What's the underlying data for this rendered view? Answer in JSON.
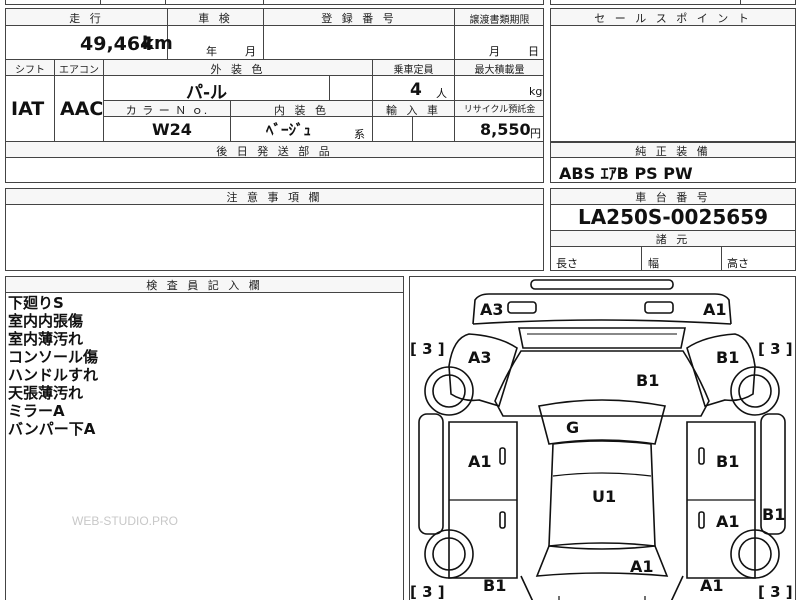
{
  "top": {
    "mileage_label": "走 行",
    "mileage_value": "49,464",
    "mileage_unit": "km",
    "inspection_label": "車 検",
    "inspection_year_unit": "年",
    "inspection_month_unit": "月",
    "reg_label": "登 録 番 号",
    "transfer_label": "譲渡書類期限",
    "transfer_month_unit": "月",
    "transfer_day_unit": "日",
    "shift_label": "シフト",
    "shift_value": "IAT",
    "ac_label": "エアコン",
    "ac_value": "AAC",
    "exterior_label": "外 装 色",
    "exterior_value": "パ-ル",
    "capacity_label": "乗車定員",
    "capacity_value": "4",
    "capacity_unit": "人",
    "load_label": "最大積載量",
    "load_unit": "kg",
    "color_no_label": "カ ラ ー Ｎ ｏ.",
    "color_no_value": "W24",
    "interior_label": "内 装 色",
    "interior_value": "ﾍﾞｰｼﾞｭ",
    "interior_unit": "系",
    "import_label": "輸 入 車",
    "recycle_label": "リサイクル預託金",
    "recycle_value": "8,550",
    "recycle_unit": "円",
    "parts_label": "後 日 発 送 部 品"
  },
  "sales": {
    "label": "セ ー ル ス ポ イ ン ト"
  },
  "equipment": {
    "label": "純 正 装 備",
    "value": "ABS ｴｱB PS PW"
  },
  "caution": {
    "label": "注 意 事 項 欄"
  },
  "chassis": {
    "label": "車 台 番 号",
    "value": "LA250S-0025659",
    "dims_label": "諸 元",
    "length_label": "長さ",
    "width_label": "幅",
    "height_label": "高さ"
  },
  "inspector": {
    "label": "検 査 員 記 入 欄",
    "notes": [
      "下廻りS",
      "室内内張傷",
      "室内薄汚れ",
      "コンソール傷",
      "ハンドルすれ",
      "天張薄汚れ",
      "ミラーA",
      "バンパー下A"
    ]
  },
  "diagram": {
    "marks": {
      "front_left": "A3",
      "front_right": "A1",
      "fender_left": "A3",
      "fender_right": "B1",
      "hood": "B1",
      "roof_front": "G",
      "roof": "U1",
      "door_fl": "A1",
      "door_fr": "B1",
      "door_rr": "A1",
      "side_rr": "B1",
      "trunk": "A1",
      "rear_left": "B1",
      "rear_right": "A1"
    },
    "tires": {
      "fl": "[ 3 ]",
      "fr": "[ 3 ]",
      "rl": "[ 3 ]",
      "rr": "[ 3 ]"
    }
  },
  "watermark": "WEB-STUDIO.PRO"
}
